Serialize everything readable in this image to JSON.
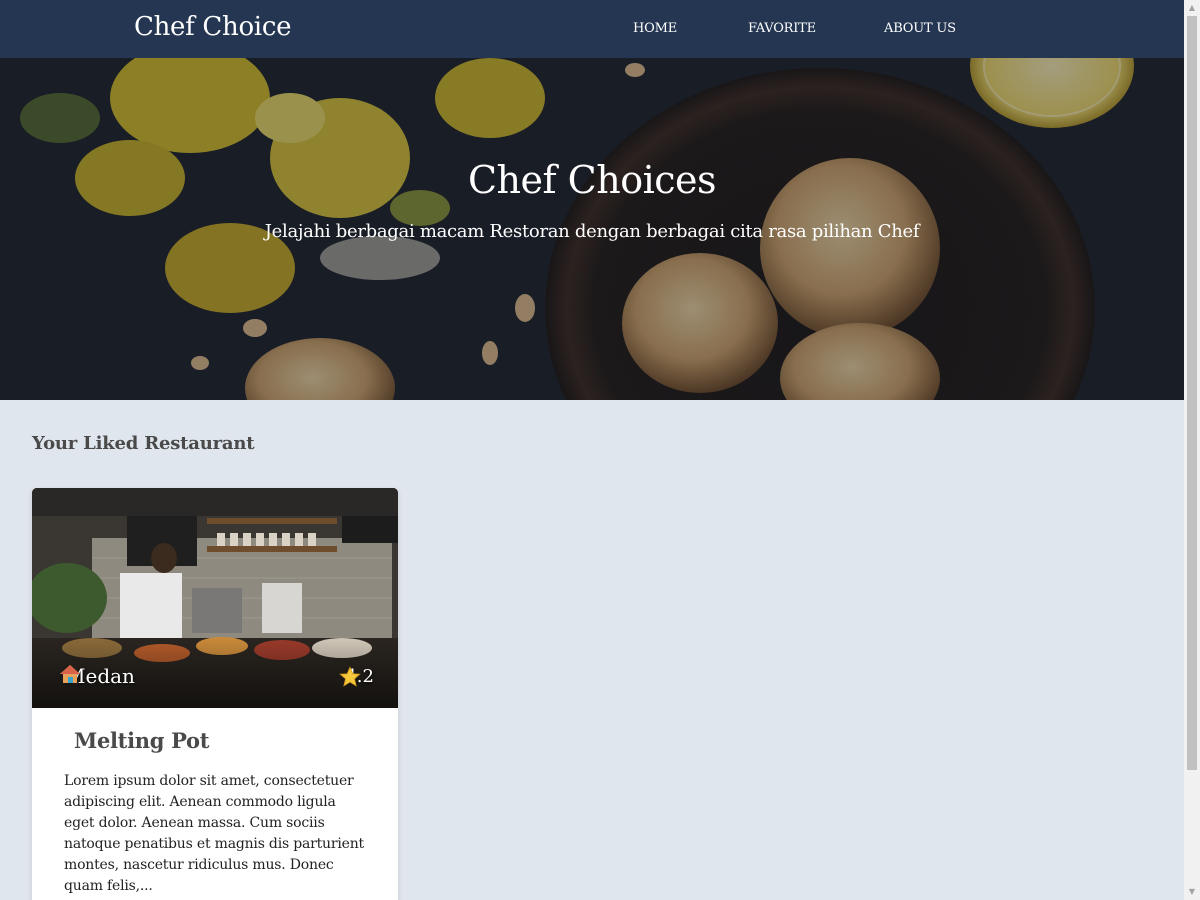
{
  "app": {
    "brand": "Chef Choice"
  },
  "nav": {
    "items": [
      {
        "label": "HOME"
      },
      {
        "label": "FAVORITE"
      },
      {
        "label": "ABOUT US"
      }
    ]
  },
  "hero": {
    "title": "Chef Choices",
    "subtitle": "Jelajahi berbagai macam Restoran dengan berbagai cita rasa pilihan Chef"
  },
  "main": {
    "section_title": "Your Liked Restaurant",
    "restaurants": [
      {
        "name": "Melting Pot",
        "city": "Medan",
        "city_icon": "house-icon",
        "rating": "4.2",
        "rating_icon": "star-icon",
        "description": "Lorem ipsum dolor sit amet, consectetuer adipiscing elit. Aenean commodo ligula eget dolor. Aenean massa. Cum sociis natoque penatibus et magnis dis parturient montes, nascetur ridiculus mus. Donec quam felis,..."
      }
    ]
  },
  "colors": {
    "navbar": "#243652",
    "page_background": "#e0e6ed",
    "card_background": "#ffffff"
  }
}
